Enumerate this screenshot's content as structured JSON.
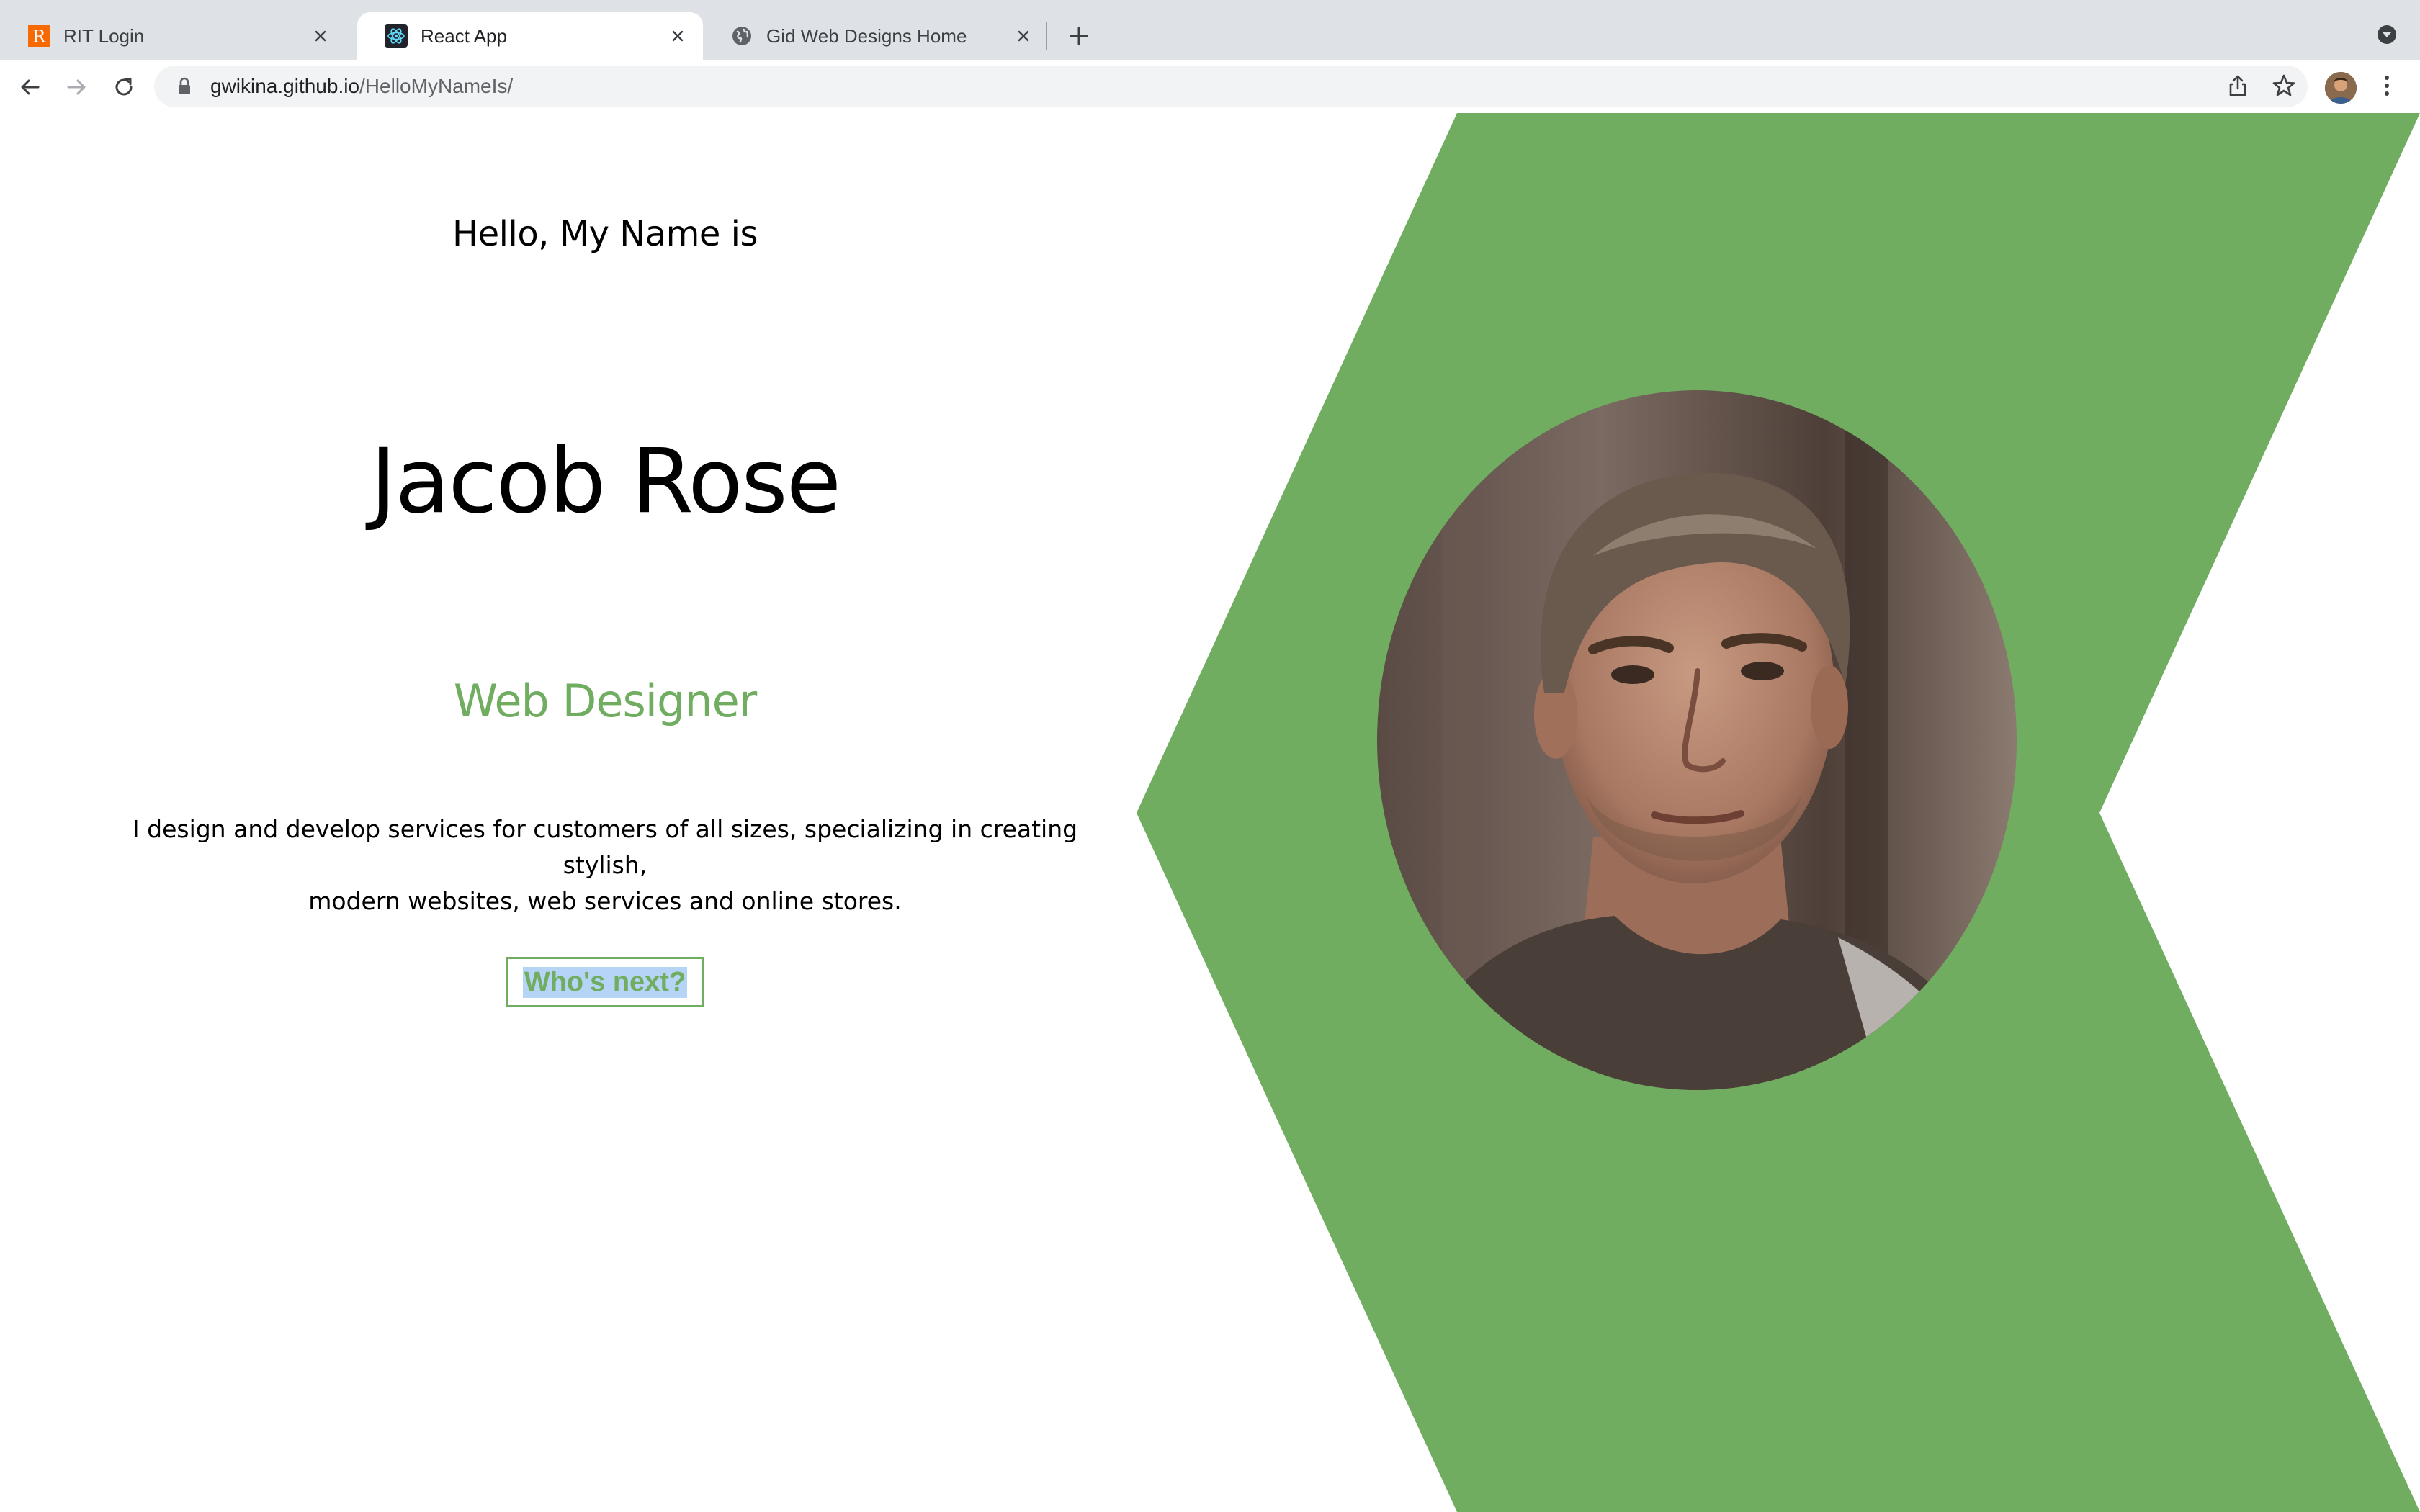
{
  "browser": {
    "tabs": [
      {
        "title": "RIT Login",
        "active": false
      },
      {
        "title": "React App",
        "active": true
      },
      {
        "title": "Gid Web Designs Home",
        "active": false
      }
    ],
    "url_host": "gwikina.github.io",
    "url_path": "/HelloMyNameIs/"
  },
  "page": {
    "greeting": "Hello, My Name is",
    "name": "Jacob Rose",
    "role": "Web Designer",
    "bio_line1": "I design and develop services for customers of all sizes, specializing in creating stylish,",
    "bio_line2": "modern websites, web services and online stores.",
    "cta_label": "Who's next?"
  },
  "colors": {
    "accent": "#70ad60",
    "tabbar": "#dee1e6",
    "omnibox": "#f1f3f4"
  },
  "icons": {
    "back": "arrow-left-icon",
    "forward": "arrow-right-icon",
    "reload": "reload-icon",
    "lock": "lock-icon",
    "share": "share-icon",
    "bookmark": "star-icon",
    "menu": "kebab-menu-icon"
  }
}
